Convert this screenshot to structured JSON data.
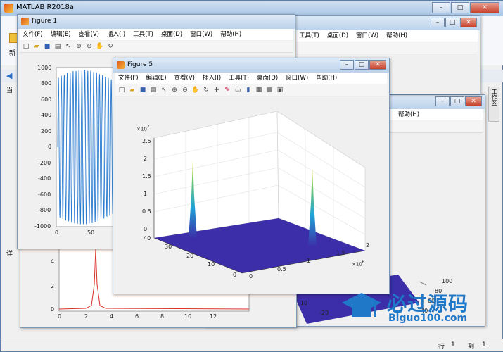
{
  "app": {
    "title": "MATLAB R2018a"
  },
  "main_window": {
    "left_labels": [
      "新",
      "当",
      "详"
    ],
    "right_tab": "工作区",
    "status": {
      "row_label": "行",
      "row_value": "1",
      "col_label": "列",
      "col_value": "1"
    }
  },
  "figure_menu": [
    "文件(F)",
    "编辑(E)",
    "查看(V)",
    "插入(I)",
    "工具(T)",
    "桌面(D)",
    "窗口(W)",
    "帮助(H)"
  ],
  "figure_back_menu": [
    "工具(T)",
    "桌面(D)",
    "窗口(W)",
    "帮助(H)"
  ],
  "figure_back2_menu": [
    "帮助(H)"
  ],
  "toolbar_icons": [
    "new-file",
    "open",
    "save",
    "print",
    "pointer",
    "zoom-in",
    "zoom-out",
    "pan",
    "rotate",
    "data-cursor",
    "brush",
    "link",
    "colorbar",
    "legend",
    "hide",
    "dock"
  ],
  "figure1": {
    "title": "Figure 1",
    "y_ticks": [
      "1000",
      "800",
      "600",
      "400",
      "200",
      "0",
      "-200",
      "-400",
      "-600",
      "-800",
      "-1000"
    ],
    "x_ticks": [
      "0",
      "50"
    ]
  },
  "figure5": {
    "title": "Figure 5",
    "z_exponent": "×10",
    "z_exponent_power": "7",
    "z_ticks": [
      "2.5",
      "2",
      "1.5",
      "1",
      "0.5",
      "0"
    ],
    "y_ticks": [
      "40",
      "30",
      "20",
      "10",
      "0"
    ],
    "x_ticks": [
      "0",
      "0.5",
      "1",
      "1.5",
      "2"
    ],
    "x_exponent": "×10",
    "x_exponent_power": "6"
  },
  "bottom_plot": {
    "y_ticks": [
      "4",
      "2",
      "0"
    ],
    "x_ticks": [
      "0",
      "2",
      "4",
      "6",
      "8",
      "10",
      "12"
    ]
  },
  "back_3d": {
    "y_ticks": [
      "100",
      "80",
      "60",
      "40"
    ],
    "x_ticks": [
      "-10",
      "-20"
    ]
  },
  "watermark": {
    "text": "必过源码",
    "url": "Biguo100.com"
  },
  "colors": {
    "line_blue": "#2b7bcf",
    "surface": "#3b2ea8",
    "red_line": "#d9302a"
  }
}
